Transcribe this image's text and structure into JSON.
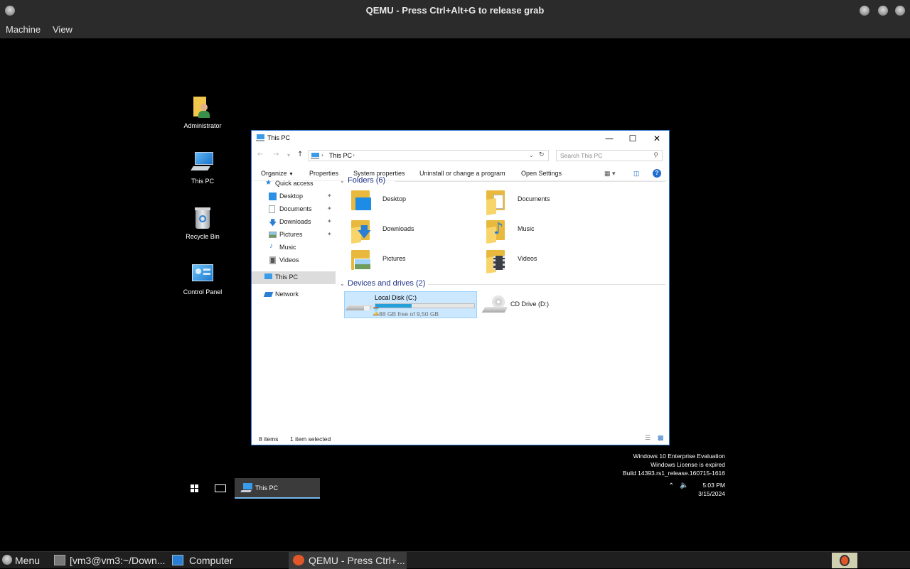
{
  "host": {
    "title": "QEMU - Press Ctrl+Alt+G to release grab",
    "menu": [
      "Machine",
      "View"
    ],
    "taskbar": {
      "menu_label": "Menu",
      "items": [
        "[vm3@vm3:~/Down...",
        "Computer",
        "QEMU - Press Ctrl+..."
      ]
    }
  },
  "desktop": {
    "icons": [
      "Administrator",
      "This PC",
      "Recycle Bin",
      "Control Panel"
    ]
  },
  "explorer": {
    "title": "This PC",
    "address": "This PC",
    "search_placeholder": "Search This PC",
    "commands": [
      "Organize",
      "Properties",
      "System properties",
      "Uninstall or change a program",
      "Open Settings"
    ],
    "nav": {
      "quick_access": "Quick access",
      "pinned": [
        "Desktop",
        "Documents",
        "Downloads",
        "Pictures"
      ],
      "other": [
        "Music",
        "Videos"
      ],
      "this_pc": "This PC",
      "network": "Network"
    },
    "folders_header": "Folders (6)",
    "folders": [
      "Desktop",
      "Documents",
      "Downloads",
      "Music",
      "Pictures",
      "Videos"
    ],
    "drives_header": "Devices and drives (2)",
    "drives": {
      "c": {
        "name": "Local Disk (C:)",
        "free": "88 GB free of 9,50 GB",
        "used_fraction": 0.37
      },
      "d": {
        "name": "CD Drive (D:)"
      }
    },
    "status": {
      "items": "8 items",
      "selected": "1 item selected"
    }
  },
  "watermark": {
    "line1": "Windows 10 Enterprise Evaluation",
    "line2": "Windows License is expired",
    "line3": "Build 14393.rs1_release.160715-1616"
  },
  "guest_taskbar": {
    "task_label": "This PC",
    "time": "5:03 PM",
    "date": "3/15/2024"
  },
  "colors": {
    "accent": "#2b79d3",
    "selection": "#cce8ff",
    "drive_fill": "#26a0da"
  }
}
